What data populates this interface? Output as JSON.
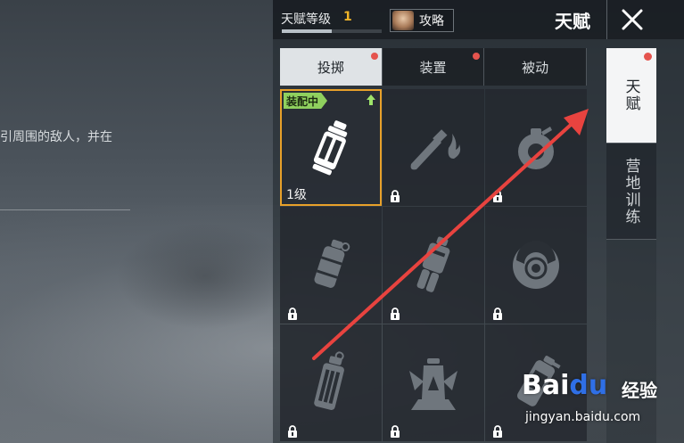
{
  "background": {
    "description_text": "引周围的敌人，并在"
  },
  "header": {
    "talent_level_label": "天赋等级",
    "talent_level_value": "1",
    "talent_level_progress": 0.5,
    "guide_label": "攻略",
    "title": "天赋",
    "close_icon": "close-x-icon"
  },
  "tabs": [
    {
      "label": "投掷",
      "active": true,
      "has_dot": true
    },
    {
      "label": "装置",
      "active": false,
      "has_dot": true
    },
    {
      "label": "被动",
      "active": false,
      "has_dot": false
    }
  ],
  "grid": {
    "equipped_badge": "装配中",
    "selected_level": "1级",
    "items": [
      {
        "icon": "canister-grenade-icon",
        "locked": false,
        "selected": true
      },
      {
        "icon": "molotov-icon",
        "locked": true
      },
      {
        "icon": "frag-grenade-icon",
        "locked": true
      },
      {
        "icon": "smoke-grenade-icon",
        "locked": true
      },
      {
        "icon": "cluster-grenade-icon",
        "locked": true
      },
      {
        "icon": "disc-mine-icon",
        "locked": true
      },
      {
        "icon": "stun-grenade-icon",
        "locked": true
      },
      {
        "icon": "trap-device-icon",
        "locked": true
      },
      {
        "icon": "spray-canister-icon",
        "locked": true
      }
    ]
  },
  "side_tabs": [
    {
      "label": "天赋",
      "active": true,
      "has_dot": true
    },
    {
      "label": "营地训练",
      "active": false,
      "has_dot": false
    }
  ],
  "watermark": {
    "brand_bai": "Bai",
    "brand_du": "du",
    "brand_cn": "经验",
    "url": "jingyan.baidu.com"
  },
  "colors": {
    "accent_orange": "#e8a12a",
    "badge_green": "#8fd05e",
    "notify_red": "#e5544e",
    "arrow_red": "#e8433f"
  }
}
